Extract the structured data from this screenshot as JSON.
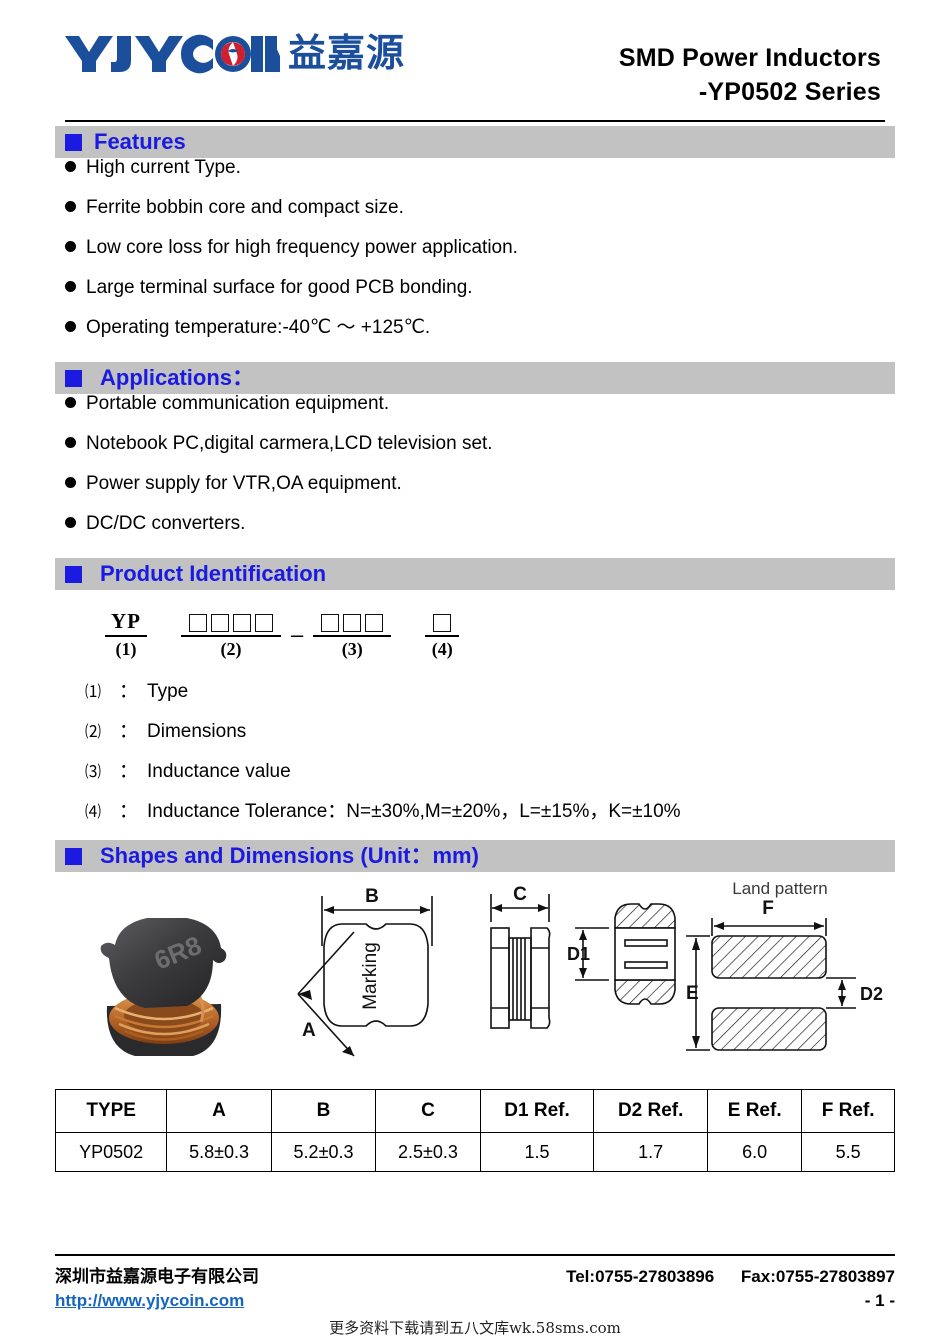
{
  "header": {
    "logo_latin": "YJYCOIN",
    "logo_chinese": "益嘉源",
    "title_line1": "SMD Power Inductors",
    "title_line2": "-YP0502 Series"
  },
  "features": {
    "heading": "Features",
    "items": [
      "High current Type.",
      "Ferrite bobbin core and compact size.",
      "Low core loss for high frequency power application.",
      "Large terminal surface for good PCB bonding.",
      "Operating temperature:-40℃ ～ +125℃."
    ]
  },
  "applications": {
    "heading": "Applications：",
    "items": [
      "Portable communication equipment.",
      "Notebook PC,digital carmera,LCD television set.",
      "Power supply for VTR,OA equipment.",
      "DC/DC converters."
    ]
  },
  "product_identification": {
    "heading": "Product Identification",
    "part_number": {
      "segment1_text": "YP",
      "segment1_index": "(1)",
      "segment2_boxes": 4,
      "segment2_index": "(2)",
      "separator": "–",
      "segment3_boxes": 3,
      "segment3_index": "(3)",
      "segment4_boxes": 1,
      "segment4_index": "(4)"
    },
    "legend": [
      {
        "num": "⑴",
        "colon": "：",
        "text": "Type"
      },
      {
        "num": "⑵",
        "colon": "：",
        "text": "Dimensions"
      },
      {
        "num": "⑶",
        "colon": "：",
        "text": "Inductance value"
      },
      {
        "num": "⑷",
        "colon": "：",
        "text": "Inductance Tolerance：N=±30%,M=±20%，L=±15%，K=±10%"
      }
    ]
  },
  "shapes": {
    "heading": "Shapes and Dimensions (Unit：mm)",
    "photo_marking": "6R8",
    "labels": {
      "marking": "Marking",
      "dim_a": "A",
      "dim_b": "B",
      "dim_c": "C",
      "dim_d1": "D1",
      "dim_d2": "D2",
      "dim_e": "E",
      "dim_f": "F",
      "land_pattern": "Land pattern"
    }
  },
  "dimension_table": {
    "columns": [
      "TYPE",
      "A",
      "B",
      "C",
      "D1 Ref.",
      "D2 Ref.",
      "E Ref.",
      "F Ref."
    ],
    "rows": [
      [
        "YP0502",
        "5.8±0.3",
        "5.2±0.3",
        "2.5±0.3",
        "1.5",
        "1.7",
        "6.0",
        "5.5"
      ]
    ]
  },
  "footer": {
    "company": "深圳市益嘉源电子有限公司",
    "tel": "Tel:0755-27803896",
    "fax": "Fax:0755-27803897",
    "url": "http://www.yjycoin.com",
    "page": "- 1 -",
    "watermark": "更多资料下载请到五八文库wk.58sms.com"
  },
  "colors": {
    "accent_blue": "#1a1ae0",
    "bar_gray": "#c2c2c2",
    "logo_blue": "#1b4f9c",
    "logo_red": "#d0202f",
    "link_blue": "#1565c0"
  }
}
